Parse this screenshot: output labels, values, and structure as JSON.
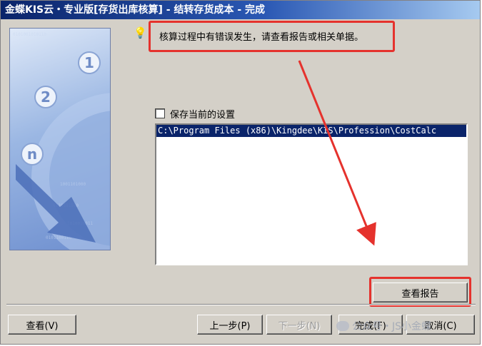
{
  "window": {
    "title": "金蝶KIS云・专业版[存货出库核算] - 结转存货成本 - 完成"
  },
  "banner": {
    "step_numbers": [
      "1",
      "2",
      "n"
    ]
  },
  "hint": {
    "icon": "lightbulb-icon",
    "message": "核算过程中有错误发生，请查看报告或相关单据。"
  },
  "settings": {
    "save_label": "保存当前的设置",
    "save_checked": false
  },
  "report_list": {
    "items": [
      "C:\\Program Files (x86)\\Kingdee\\KIS\\Profession\\CostCalc"
    ]
  },
  "buttons": {
    "view_report": "查看报告",
    "view": "查看(V)",
    "prev": "上一步(P)",
    "next": "下一步(N)",
    "finish": "完成(F)",
    "cancel": "取消(C)"
  },
  "watermark": {
    "text": "公众号・JS小金蝶"
  },
  "colors": {
    "highlight": "#e5322d",
    "selection": "#0a246a",
    "title_bar": "#0a246a"
  }
}
